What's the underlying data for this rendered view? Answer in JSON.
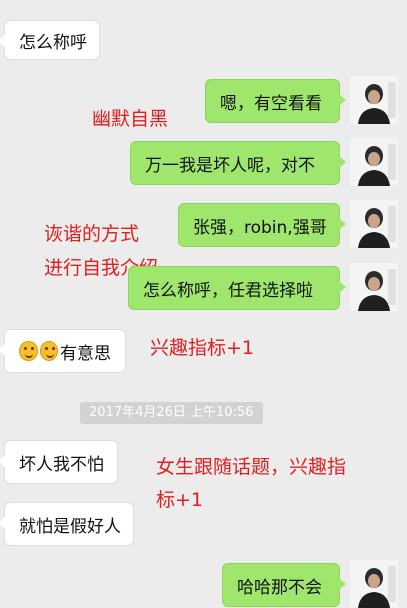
{
  "messages": [
    {
      "from": "them",
      "text": "怎么称呼"
    },
    {
      "from": "me",
      "text": "嗯，有空看看"
    },
    {
      "from": "me",
      "text": "万一我是坏人呢，对不"
    },
    {
      "from": "me",
      "text": "张强，robin,强哥"
    },
    {
      "from": "me",
      "text": "怎么称呼，任君选择啦"
    },
    {
      "from": "them",
      "emojis": [
        "grinning-face-emoji",
        "grinning-face-emoji"
      ],
      "text": "有意思"
    },
    {
      "from": "them",
      "text": "坏人我不怕"
    },
    {
      "from": "them",
      "text": "就怕是假好人"
    },
    {
      "from": "me",
      "text": "哈哈那不会"
    }
  ],
  "timestamp": "2017年4月26日 上午10:56",
  "annotations": {
    "humor": "幽默自黑",
    "witty_line1": "诙谐的方式",
    "witty_line2": "进行自我介绍",
    "interest": "兴趣指标+1",
    "follow_line1": "女生跟随话题，兴趣指",
    "follow_line2": "标+1"
  },
  "colors": {
    "background": "#ececec",
    "outgoing_bubble": "#9fe66d",
    "incoming_bubble": "#ffffff",
    "annotation": "#e02020",
    "timestamp_bg": "#d2d2d2"
  }
}
